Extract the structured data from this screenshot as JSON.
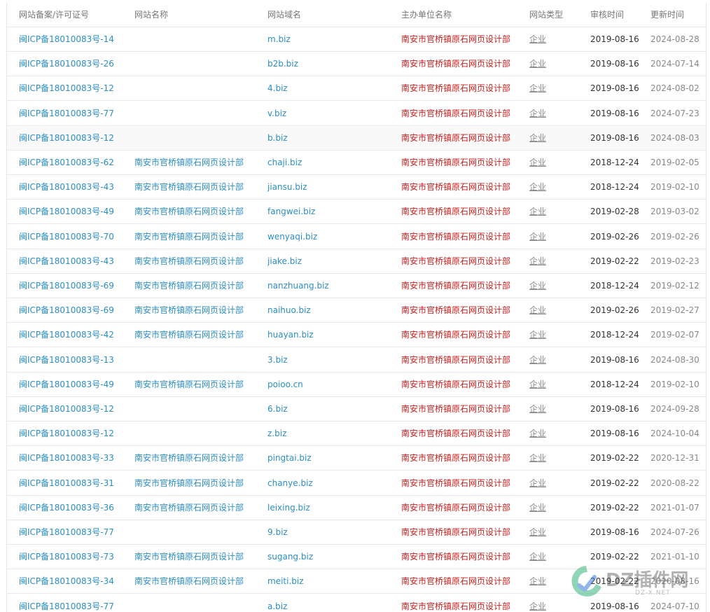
{
  "columns": {
    "license": "网站备案/许可证号",
    "site_name": "网站名称",
    "domain": "网站域名",
    "organizer": "主办单位名称",
    "type": "网站类型",
    "audit_time": "审核时间",
    "update_time": "更新时间"
  },
  "rows": [
    {
      "license": "闽ICP备18010083号-14",
      "site_name": "",
      "domain": "m.biz",
      "organizer": "南安市官桥镇原石网页设计部",
      "type": "企业",
      "audit_time": "2019-08-16",
      "update_time": "2024-08-28"
    },
    {
      "license": "闽ICP备18010083号-26",
      "site_name": "",
      "domain": "b2b.biz",
      "organizer": "南安市官桥镇原石网页设计部",
      "type": "企业",
      "audit_time": "2019-08-16",
      "update_time": "2024-07-14"
    },
    {
      "license": "闽ICP备18010083号-12",
      "site_name": "",
      "domain": "4.biz",
      "organizer": "南安市官桥镇原石网页设计部",
      "type": "企业",
      "audit_time": "2019-08-16",
      "update_time": "2024-08-02"
    },
    {
      "license": "闽ICP备18010083号-77",
      "site_name": "",
      "domain": "v.biz",
      "organizer": "南安市官桥镇原石网页设计部",
      "type": "企业",
      "audit_time": "2019-08-16",
      "update_time": "2024-07-23"
    },
    {
      "license": "闽ICP备18010083号-12",
      "site_name": "",
      "domain": "b.biz",
      "organizer": "南安市官桥镇原石网页设计部",
      "type": "企业",
      "audit_time": "2019-08-16",
      "update_time": "2024-08-03"
    },
    {
      "license": "闽ICP备18010083号-62",
      "site_name": "南安市官桥镇原石网页设计部",
      "domain": "chaji.biz",
      "organizer": "南安市官桥镇原石网页设计部",
      "type": "企业",
      "audit_time": "2018-12-24",
      "update_time": "2019-02-05"
    },
    {
      "license": "闽ICP备18010083号-43",
      "site_name": "南安市官桥镇原石网页设计部",
      "domain": "jiansu.biz",
      "organizer": "南安市官桥镇原石网页设计部",
      "type": "企业",
      "audit_time": "2018-12-24",
      "update_time": "2019-02-10"
    },
    {
      "license": "闽ICP备18010083号-49",
      "site_name": "南安市官桥镇原石网页设计部",
      "domain": "fangwei.biz",
      "organizer": "南安市官桥镇原石网页设计部",
      "type": "企业",
      "audit_time": "2019-02-28",
      "update_time": "2019-03-02"
    },
    {
      "license": "闽ICP备18010083号-70",
      "site_name": "南安市官桥镇原石网页设计部",
      "domain": "wenyaqi.biz",
      "organizer": "南安市官桥镇原石网页设计部",
      "type": "企业",
      "audit_time": "2019-02-26",
      "update_time": "2019-02-26"
    },
    {
      "license": "闽ICP备18010083号-43",
      "site_name": "南安市官桥镇原石网页设计部",
      "domain": "jiake.biz",
      "organizer": "南安市官桥镇原石网页设计部",
      "type": "企业",
      "audit_time": "2019-02-22",
      "update_time": "2019-02-23"
    },
    {
      "license": "闽ICP备18010083号-69",
      "site_name": "南安市官桥镇原石网页设计部",
      "domain": "nanzhuang.biz",
      "organizer": "南安市官桥镇原石网页设计部",
      "type": "企业",
      "audit_time": "2018-12-24",
      "update_time": "2019-02-12"
    },
    {
      "license": "闽ICP备18010083号-69",
      "site_name": "南安市官桥镇原石网页设计部",
      "domain": "naihuo.biz",
      "organizer": "南安市官桥镇原石网页设计部",
      "type": "企业",
      "audit_time": "2019-02-26",
      "update_time": "2019-02-27"
    },
    {
      "license": "闽ICP备18010083号-42",
      "site_name": "南安市官桥镇原石网页设计部",
      "domain": "huayan.biz",
      "organizer": "南安市官桥镇原石网页设计部",
      "type": "企业",
      "audit_time": "2018-12-24",
      "update_time": "2019-02-07"
    },
    {
      "license": "闽ICP备18010083号-13",
      "site_name": "",
      "domain": "3.biz",
      "organizer": "南安市官桥镇原石网页设计部",
      "type": "企业",
      "audit_time": "2019-08-16",
      "update_time": "2024-08-30"
    },
    {
      "license": "闽ICP备18010083号-49",
      "site_name": "南安市官桥镇原石网页设计部",
      "domain": "poioo.cn",
      "organizer": "南安市官桥镇原石网页设计部",
      "type": "企业",
      "audit_time": "2018-12-24",
      "update_time": "2019-02-10"
    },
    {
      "license": "闽ICP备18010083号-12",
      "site_name": "",
      "domain": "6.biz",
      "organizer": "南安市官桥镇原石网页设计部",
      "type": "企业",
      "audit_time": "2019-08-16",
      "update_time": "2024-09-28"
    },
    {
      "license": "闽ICP备18010083号-12",
      "site_name": "",
      "domain": "z.biz",
      "organizer": "南安市官桥镇原石网页设计部",
      "type": "企业",
      "audit_time": "2019-08-16",
      "update_time": "2024-10-04"
    },
    {
      "license": "闽ICP备18010083号-33",
      "site_name": "南安市官桥镇原石网页设计部",
      "domain": "pingtai.biz",
      "organizer": "南安市官桥镇原石网页设计部",
      "type": "企业",
      "audit_time": "2019-02-22",
      "update_time": "2020-12-31"
    },
    {
      "license": "闽ICP备18010083号-31",
      "site_name": "南安市官桥镇原石网页设计部",
      "domain": "chanye.biz",
      "organizer": "南安市官桥镇原石网页设计部",
      "type": "企业",
      "audit_time": "2019-02-22",
      "update_time": "2020-08-22"
    },
    {
      "license": "闽ICP备18010083号-36",
      "site_name": "南安市官桥镇原石网页设计部",
      "domain": "leixing.biz",
      "organizer": "南安市官桥镇原石网页设计部",
      "type": "企业",
      "audit_time": "2019-02-22",
      "update_time": "2021-01-07"
    },
    {
      "license": "闽ICP备18010083号-77",
      "site_name": "",
      "domain": "9.biz",
      "organizer": "南安市官桥镇原石网页设计部",
      "type": "企业",
      "audit_time": "2019-08-16",
      "update_time": "2024-07-26"
    },
    {
      "license": "闽ICP备18010083号-73",
      "site_name": "南安市官桥镇原石网页设计部",
      "domain": "sugang.biz",
      "organizer": "南安市官桥镇原石网页设计部",
      "type": "企业",
      "audit_time": "2019-02-22",
      "update_time": "2021-01-10"
    },
    {
      "license": "闽ICP备18010083号-34",
      "site_name": "南安市官桥镇原石网页设计部",
      "domain": "meiti.biz",
      "organizer": "南安市官桥镇原石网页设计部",
      "type": "企业",
      "audit_time": "2019-02-22",
      "update_time": "2020-08-16"
    },
    {
      "license": "闽ICP备18010083号-77",
      "site_name": "",
      "domain": "a.biz",
      "organizer": "南安市官桥镇原石网页设计部",
      "type": "企业",
      "audit_time": "2019-08-16",
      "update_time": "2024-07-10"
    }
  ],
  "watermark": {
    "brand": "DZ插件网",
    "url": "DZ-X.NET"
  },
  "colors": {
    "link": "#2a8ec6",
    "organizer": "#c9201e",
    "muted": "#888888",
    "logo_green": "#36b37e",
    "logo_blue": "#3a7bd5"
  }
}
